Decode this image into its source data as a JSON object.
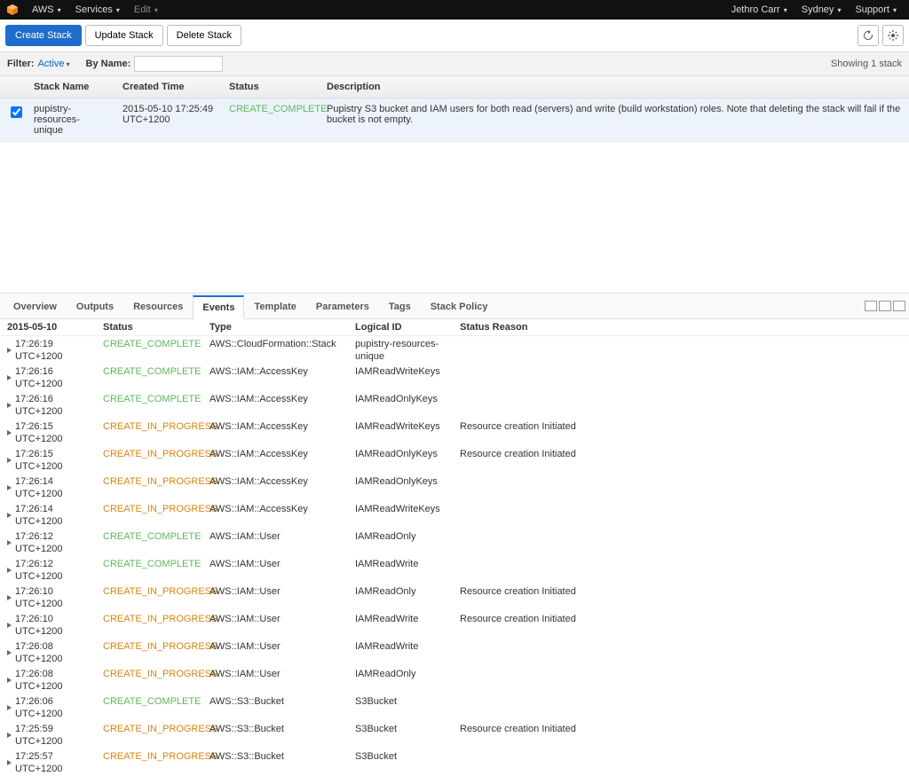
{
  "topnav": {
    "aws": "AWS",
    "services": "Services",
    "edit": "Edit",
    "user": "Jethro Carr",
    "region": "Sydney",
    "support": "Support"
  },
  "actions": {
    "create": "Create Stack",
    "update": "Update Stack",
    "delete": "Delete Stack"
  },
  "filter": {
    "label": "Filter:",
    "active": "Active",
    "by_name": "By Name:",
    "search_placeholder": "",
    "status": "Showing 1 stack"
  },
  "stacks": {
    "headers": {
      "name": "Stack Name",
      "created": "Created Time",
      "status": "Status",
      "desc": "Description"
    },
    "rows": [
      {
        "name": "pupistry-resources-unique",
        "created": "2015-05-10 17:25:49 UTC+1200",
        "status": "CREATE_COMPLETE",
        "status_class": "status-green",
        "desc": "Pupistry S3 bucket and IAM users for both read (servers) and write (build workstation) roles. Note that deleting the stack will fail if the bucket is not empty."
      }
    ]
  },
  "tabs": [
    "Overview",
    "Outputs",
    "Resources",
    "Events",
    "Template",
    "Parameters",
    "Tags",
    "Stack Policy"
  ],
  "active_tab": "Events",
  "events": {
    "date": "2015-05-10",
    "headers": {
      "status": "Status",
      "type": "Type",
      "logical": "Logical ID",
      "reason": "Status Reason"
    },
    "rows": [
      {
        "time": "17:26:19 UTC+1200",
        "status": "CREATE_COMPLETE",
        "sc": "status-green",
        "type": "AWS::CloudFormation::Stack",
        "logical": "pupistry-resources-unique",
        "reason": ""
      },
      {
        "time": "17:26:16 UTC+1200",
        "status": "CREATE_COMPLETE",
        "sc": "status-green",
        "type": "AWS::IAM::AccessKey",
        "logical": "IAMReadWriteKeys",
        "reason": ""
      },
      {
        "time": "17:26:16 UTC+1200",
        "status": "CREATE_COMPLETE",
        "sc": "status-green",
        "type": "AWS::IAM::AccessKey",
        "logical": "IAMReadOnlyKeys",
        "reason": ""
      },
      {
        "time": "17:26:15 UTC+1200",
        "status": "CREATE_IN_PROGRESS",
        "sc": "status-orange",
        "type": "AWS::IAM::AccessKey",
        "logical": "IAMReadWriteKeys",
        "reason": "Resource creation Initiated"
      },
      {
        "time": "17:26:15 UTC+1200",
        "status": "CREATE_IN_PROGRESS",
        "sc": "status-orange",
        "type": "AWS::IAM::AccessKey",
        "logical": "IAMReadOnlyKeys",
        "reason": "Resource creation Initiated"
      },
      {
        "time": "17:26:14 UTC+1200",
        "status": "CREATE_IN_PROGRESS",
        "sc": "status-orange",
        "type": "AWS::IAM::AccessKey",
        "logical": "IAMReadOnlyKeys",
        "reason": ""
      },
      {
        "time": "17:26:14 UTC+1200",
        "status": "CREATE_IN_PROGRESS",
        "sc": "status-orange",
        "type": "AWS::IAM::AccessKey",
        "logical": "IAMReadWriteKeys",
        "reason": ""
      },
      {
        "time": "17:26:12 UTC+1200",
        "status": "CREATE_COMPLETE",
        "sc": "status-green",
        "type": "AWS::IAM::User",
        "logical": "IAMReadOnly",
        "reason": ""
      },
      {
        "time": "17:26:12 UTC+1200",
        "status": "CREATE_COMPLETE",
        "sc": "status-green",
        "type": "AWS::IAM::User",
        "logical": "IAMReadWrite",
        "reason": ""
      },
      {
        "time": "17:26:10 UTC+1200",
        "status": "CREATE_IN_PROGRESS",
        "sc": "status-orange",
        "type": "AWS::IAM::User",
        "logical": "IAMReadOnly",
        "reason": "Resource creation Initiated"
      },
      {
        "time": "17:26:10 UTC+1200",
        "status": "CREATE_IN_PROGRESS",
        "sc": "status-orange",
        "type": "AWS::IAM::User",
        "logical": "IAMReadWrite",
        "reason": "Resource creation Initiated"
      },
      {
        "time": "17:26:08 UTC+1200",
        "status": "CREATE_IN_PROGRESS",
        "sc": "status-orange",
        "type": "AWS::IAM::User",
        "logical": "IAMReadWrite",
        "reason": ""
      },
      {
        "time": "17:26:08 UTC+1200",
        "status": "CREATE_IN_PROGRESS",
        "sc": "status-orange",
        "type": "AWS::IAM::User",
        "logical": "IAMReadOnly",
        "reason": ""
      },
      {
        "time": "17:26:06 UTC+1200",
        "status": "CREATE_COMPLETE",
        "sc": "status-green",
        "type": "AWS::S3::Bucket",
        "logical": "S3Bucket",
        "reason": ""
      },
      {
        "time": "17:25:59 UTC+1200",
        "status": "CREATE_IN_PROGRESS",
        "sc": "status-orange",
        "type": "AWS::S3::Bucket",
        "logical": "S3Bucket",
        "reason": "Resource creation Initiated"
      },
      {
        "time": "17:25:57 UTC+1200",
        "status": "CREATE_IN_PROGRESS",
        "sc": "status-orange",
        "type": "AWS::S3::Bucket",
        "logical": "S3Bucket",
        "reason": ""
      }
    ]
  }
}
